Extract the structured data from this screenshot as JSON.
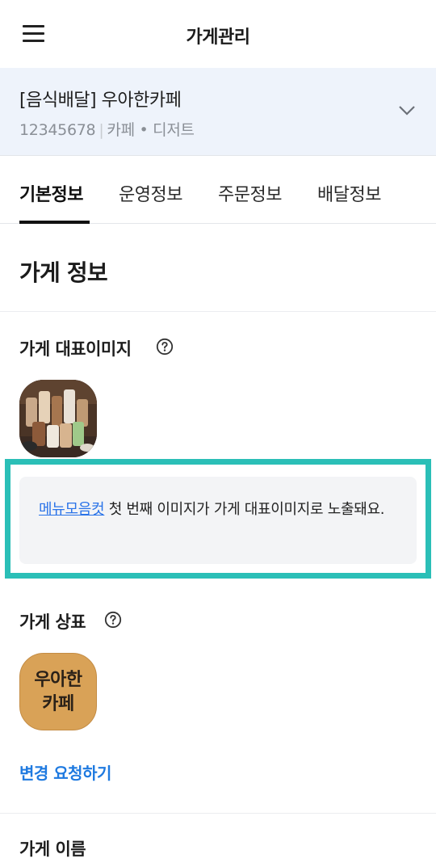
{
  "appbar": {
    "title": "가게관리",
    "menu_icon": "hamburger-menu-icon"
  },
  "store": {
    "name": "[음식배달] 우아한카페",
    "id": "12345678",
    "separator": "|",
    "category": "카페 • 디저트",
    "expand_icon": "chevron-down-icon"
  },
  "tabs": [
    {
      "label": "기본정보",
      "active": true
    },
    {
      "label": "운영정보",
      "active": false
    },
    {
      "label": "주문정보",
      "active": false
    },
    {
      "label": "배달정보",
      "active": false
    }
  ],
  "section": {
    "title": "가게 정보"
  },
  "rep_image": {
    "label": "가게 대표이미지",
    "help_icon": "question-circle-icon"
  },
  "notice": {
    "link": "메뉴모음컷",
    "text": " 첫 번째 이미지가 가게 대표이미지로 노출돼요."
  },
  "brand": {
    "label": "가게 상표",
    "help_icon": "question-circle-icon",
    "logo_line1": "우아한",
    "logo_line2": "카페",
    "change_link": "변경 요청하기"
  },
  "store_name_section": {
    "label": "가게 이름"
  },
  "colors": {
    "highlight": "#2bbfb7",
    "link": "#1f7ae0",
    "store_bg": "#eef3fb"
  }
}
